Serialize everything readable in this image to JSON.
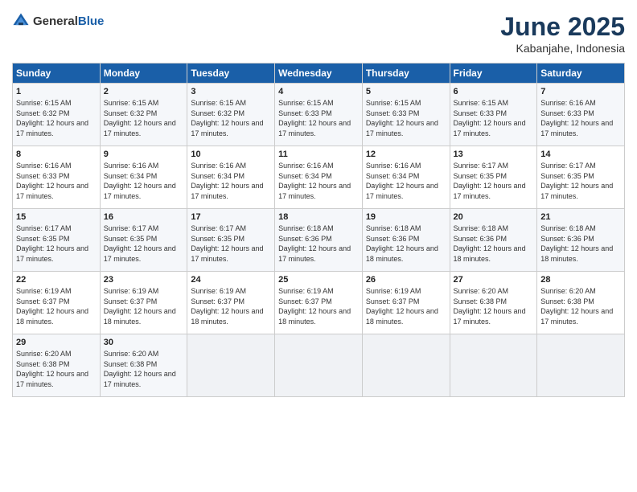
{
  "header": {
    "logo_general": "General",
    "logo_blue": "Blue",
    "month_title": "June 2025",
    "location": "Kabanjahe, Indonesia"
  },
  "weekdays": [
    "Sunday",
    "Monday",
    "Tuesday",
    "Wednesday",
    "Thursday",
    "Friday",
    "Saturday"
  ],
  "rows": [
    [
      {
        "day": "1",
        "sunrise": "6:15 AM",
        "sunset": "6:32 PM",
        "daylight": "12 hours and 17 minutes."
      },
      {
        "day": "2",
        "sunrise": "6:15 AM",
        "sunset": "6:32 PM",
        "daylight": "12 hours and 17 minutes."
      },
      {
        "day": "3",
        "sunrise": "6:15 AM",
        "sunset": "6:32 PM",
        "daylight": "12 hours and 17 minutes."
      },
      {
        "day": "4",
        "sunrise": "6:15 AM",
        "sunset": "6:33 PM",
        "daylight": "12 hours and 17 minutes."
      },
      {
        "day": "5",
        "sunrise": "6:15 AM",
        "sunset": "6:33 PM",
        "daylight": "12 hours and 17 minutes."
      },
      {
        "day": "6",
        "sunrise": "6:15 AM",
        "sunset": "6:33 PM",
        "daylight": "12 hours and 17 minutes."
      },
      {
        "day": "7",
        "sunrise": "6:16 AM",
        "sunset": "6:33 PM",
        "daylight": "12 hours and 17 minutes."
      }
    ],
    [
      {
        "day": "8",
        "sunrise": "6:16 AM",
        "sunset": "6:33 PM",
        "daylight": "12 hours and 17 minutes."
      },
      {
        "day": "9",
        "sunrise": "6:16 AM",
        "sunset": "6:34 PM",
        "daylight": "12 hours and 17 minutes."
      },
      {
        "day": "10",
        "sunrise": "6:16 AM",
        "sunset": "6:34 PM",
        "daylight": "12 hours and 17 minutes."
      },
      {
        "day": "11",
        "sunrise": "6:16 AM",
        "sunset": "6:34 PM",
        "daylight": "12 hours and 17 minutes."
      },
      {
        "day": "12",
        "sunrise": "6:16 AM",
        "sunset": "6:34 PM",
        "daylight": "12 hours and 17 minutes."
      },
      {
        "day": "13",
        "sunrise": "6:17 AM",
        "sunset": "6:35 PM",
        "daylight": "12 hours and 17 minutes."
      },
      {
        "day": "14",
        "sunrise": "6:17 AM",
        "sunset": "6:35 PM",
        "daylight": "12 hours and 17 minutes."
      }
    ],
    [
      {
        "day": "15",
        "sunrise": "6:17 AM",
        "sunset": "6:35 PM",
        "daylight": "12 hours and 17 minutes."
      },
      {
        "day": "16",
        "sunrise": "6:17 AM",
        "sunset": "6:35 PM",
        "daylight": "12 hours and 17 minutes."
      },
      {
        "day": "17",
        "sunrise": "6:17 AM",
        "sunset": "6:35 PM",
        "daylight": "12 hours and 17 minutes."
      },
      {
        "day": "18",
        "sunrise": "6:18 AM",
        "sunset": "6:36 PM",
        "daylight": "12 hours and 17 minutes."
      },
      {
        "day": "19",
        "sunrise": "6:18 AM",
        "sunset": "6:36 PM",
        "daylight": "12 hours and 18 minutes."
      },
      {
        "day": "20",
        "sunrise": "6:18 AM",
        "sunset": "6:36 PM",
        "daylight": "12 hours and 18 minutes."
      },
      {
        "day": "21",
        "sunrise": "6:18 AM",
        "sunset": "6:36 PM",
        "daylight": "12 hours and 18 minutes."
      }
    ],
    [
      {
        "day": "22",
        "sunrise": "6:19 AM",
        "sunset": "6:37 PM",
        "daylight": "12 hours and 18 minutes."
      },
      {
        "day": "23",
        "sunrise": "6:19 AM",
        "sunset": "6:37 PM",
        "daylight": "12 hours and 18 minutes."
      },
      {
        "day": "24",
        "sunrise": "6:19 AM",
        "sunset": "6:37 PM",
        "daylight": "12 hours and 18 minutes."
      },
      {
        "day": "25",
        "sunrise": "6:19 AM",
        "sunset": "6:37 PM",
        "daylight": "12 hours and 18 minutes."
      },
      {
        "day": "26",
        "sunrise": "6:19 AM",
        "sunset": "6:37 PM",
        "daylight": "12 hours and 18 minutes."
      },
      {
        "day": "27",
        "sunrise": "6:20 AM",
        "sunset": "6:38 PM",
        "daylight": "12 hours and 17 minutes."
      },
      {
        "day": "28",
        "sunrise": "6:20 AM",
        "sunset": "6:38 PM",
        "daylight": "12 hours and 17 minutes."
      }
    ],
    [
      {
        "day": "29",
        "sunrise": "6:20 AM",
        "sunset": "6:38 PM",
        "daylight": "12 hours and 17 minutes."
      },
      {
        "day": "30",
        "sunrise": "6:20 AM",
        "sunset": "6:38 PM",
        "daylight": "12 hours and 17 minutes."
      },
      null,
      null,
      null,
      null,
      null
    ]
  ],
  "labels": {
    "sunrise": "Sunrise:",
    "sunset": "Sunset:",
    "daylight": "Daylight:"
  }
}
